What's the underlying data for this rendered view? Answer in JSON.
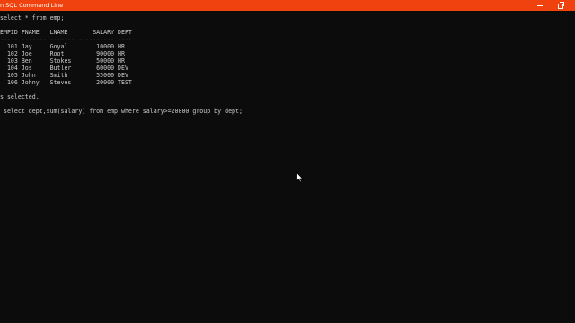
{
  "window": {
    "title": "n SQL Command Line"
  },
  "console": {
    "lines": [
      "select * from emp;",
      "",
      "EMPID FNAME   LNAME       SALARY DEPT",
      "----- ------- ------- ---------- ----",
      "  101 Jay     Goyal        10000 HR",
      "  102 Joe     Root         90000 HR",
      "  103 Ben     Stokes       50000 HR",
      "  104 Jos     Butler       60000 DEV",
      "  105 John    Smith        55000 DEV",
      "  106 Johny   Steves       20000 TEST",
      "",
      "s selected.",
      "",
      " select dept,sum(salary) from emp where salary>=20000 group by dept;"
    ]
  },
  "colors": {
    "titlebar": "#f0420e",
    "background": "#0c0c0c",
    "text": "#cccccc"
  },
  "icons": {
    "restore": "restore-icon",
    "minimize": "minimize-icon",
    "cursor": "mouse-pointer-icon"
  }
}
